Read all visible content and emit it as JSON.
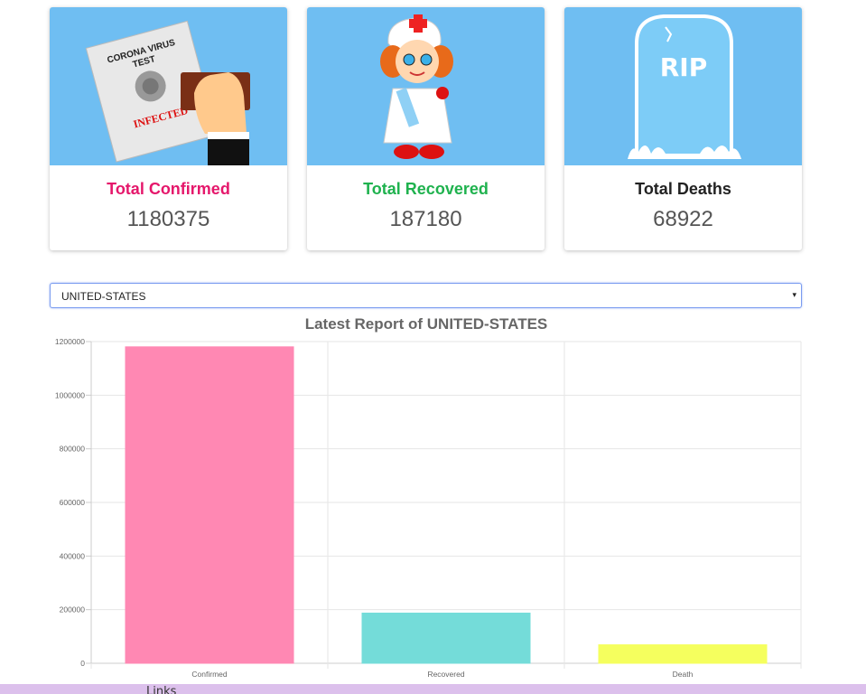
{
  "cards": [
    {
      "title": "Total Confirmed",
      "value": "1180375",
      "color": "#e5176b",
      "image_icon": "stamp-infected-icon",
      "image_text_1": "CORONA VIRUS",
      "image_text_2": "TEST",
      "image_text_3": "INFECTED"
    },
    {
      "title": "Total Recovered",
      "value": "187180",
      "color": "#1fb24e",
      "image_icon": "nurse-icon"
    },
    {
      "title": "Total Deaths",
      "value": "68922",
      "color": "#222222",
      "image_icon": "tombstone-icon",
      "image_text_1": "RIP"
    }
  ],
  "country_select": {
    "selected": "UNITED-STATES",
    "arrow": "▾"
  },
  "chart_data": {
    "type": "bar",
    "title": "Latest Report of UNITED-STATES",
    "categories": [
      "Confirmed",
      "Recovered",
      "Death"
    ],
    "values": [
      1180375,
      187180,
      68922
    ],
    "colors": [
      "#ff88b3",
      "#74dcd9",
      "#f5ff5e"
    ],
    "ylim": [
      0,
      1200000
    ],
    "yticks": [
      0,
      200000,
      400000,
      600000,
      800000,
      1000000,
      1200000
    ],
    "ytick_labels": [
      "0",
      "200000",
      "400000",
      "600000",
      "800000",
      "1000000",
      "1200000"
    ],
    "grid": true
  },
  "footer": {
    "link_label": "Links"
  }
}
